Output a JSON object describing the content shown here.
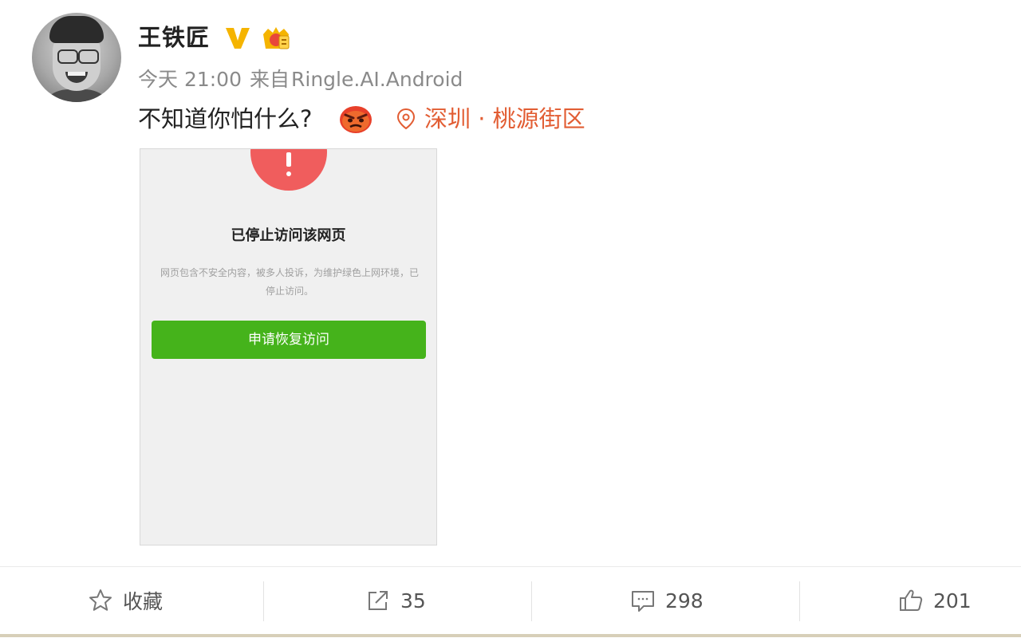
{
  "user": {
    "name": "王铁匠",
    "verified_icon": "verified-v-icon",
    "member_icon": "member-badge-icon"
  },
  "meta": {
    "time": "今天 21:00",
    "source_prefix": "来自",
    "source": "Ringle.AI.Android"
  },
  "post": {
    "text": "不知道你怕什么?",
    "emoji": "angry-face-emoji",
    "location": "深圳 · 桃源街区"
  },
  "embedded_screenshot": {
    "title": "已停止访问该网页",
    "description": "网页包含不安全内容，被多人投诉，为维护绿色上网环境，已停止访问。",
    "button": "申请恢复访问",
    "colors": {
      "warning": "#f05d5d",
      "button": "#45b31b"
    }
  },
  "actions": {
    "favorite": "收藏",
    "repost_count": "35",
    "comment_count": "298",
    "like_count": "201"
  },
  "colors": {
    "location": "#e25d33",
    "meta": "#8a8a8a"
  }
}
